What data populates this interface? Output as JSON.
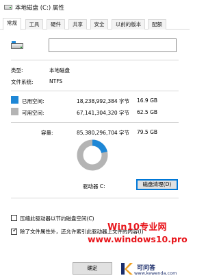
{
  "window": {
    "title": "本地磁盘 (C:) 属性"
  },
  "tabs": [
    {
      "label": "常规",
      "active": true
    },
    {
      "label": "工具",
      "active": false
    },
    {
      "label": "硬件",
      "active": false
    },
    {
      "label": "共享",
      "active": false
    },
    {
      "label": "安全",
      "active": false
    },
    {
      "label": "以前的版本",
      "active": false
    },
    {
      "label": "配额",
      "active": false
    }
  ],
  "general": {
    "drive_icon": "hard-drive-icon",
    "name_value": "",
    "type_label": "类型:",
    "type_value": "本地磁盘",
    "fs_label": "文件系统:",
    "fs_value": "NTFS",
    "used": {
      "label": "已用空间:",
      "bytes": "18,238,992,384 字节",
      "size": "16.9 GB",
      "color": "#1e87d6",
      "fraction": 0.213
    },
    "free": {
      "label": "可用空间:",
      "bytes": "67,141,304,320 字节",
      "size": "62.5 GB",
      "color": "#b4b4b4"
    },
    "capacity": {
      "label": "容量:",
      "bytes": "85,380,296,704 字节",
      "size": "79.5 GB"
    },
    "drive_label": "驱动器 C:",
    "cleanup_button": "磁盘清理(D)",
    "compress_label": "压缩此驱动器以节约磁盘空间(C)",
    "compress_checked": false,
    "index_label": "除了文件属性外，还允许索引此驱动器上文件的内容(I)",
    "index_checked": true
  },
  "footer": {
    "ok_button": "确定"
  },
  "watermark": {
    "line1": "Win10专业网",
    "line2": "www.windows10.pro",
    "color": "#e8151b"
  },
  "badge": {
    "name": "可问答",
    "url": "www.kewenda.com",
    "color": "#1b2d6b"
  }
}
